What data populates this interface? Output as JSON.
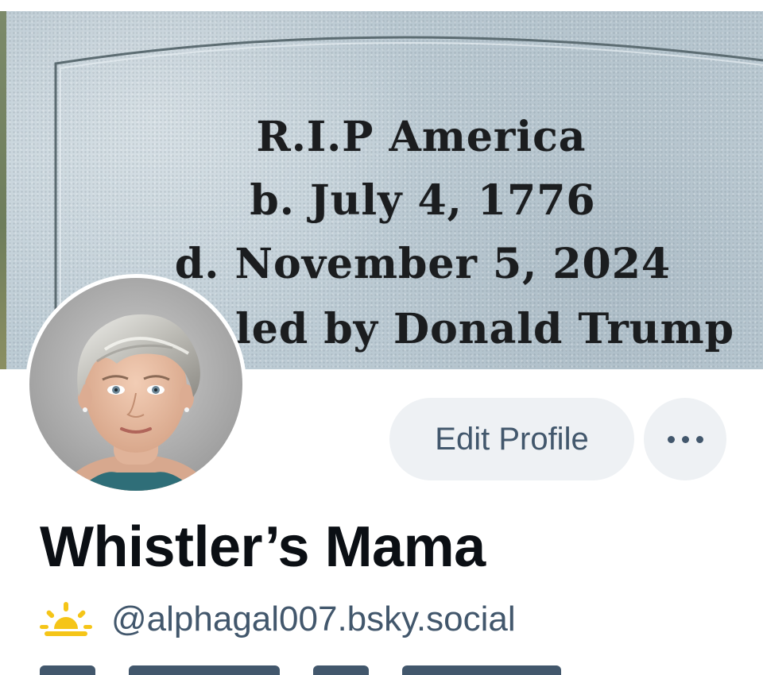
{
  "banner": {
    "epitaph_lines": [
      "R.I.P   America",
      "b. July 4, 1776",
      "d. November 5, 2024",
      "led by Donald Trump"
    ]
  },
  "profile": {
    "display_name": "Whistler’s Mama",
    "handle": "@alphagal007.bsky.social",
    "handle_icon": "sun-horizon-icon"
  },
  "actions": {
    "edit_profile_label": "Edit Profile",
    "more_icon": "ellipsis-icon"
  },
  "colors": {
    "button_bg": "#eef1f4",
    "button_text": "#42576c",
    "name_text": "#0b0f14",
    "handle_text": "#42576c",
    "sun_icon": "#f5c518"
  }
}
